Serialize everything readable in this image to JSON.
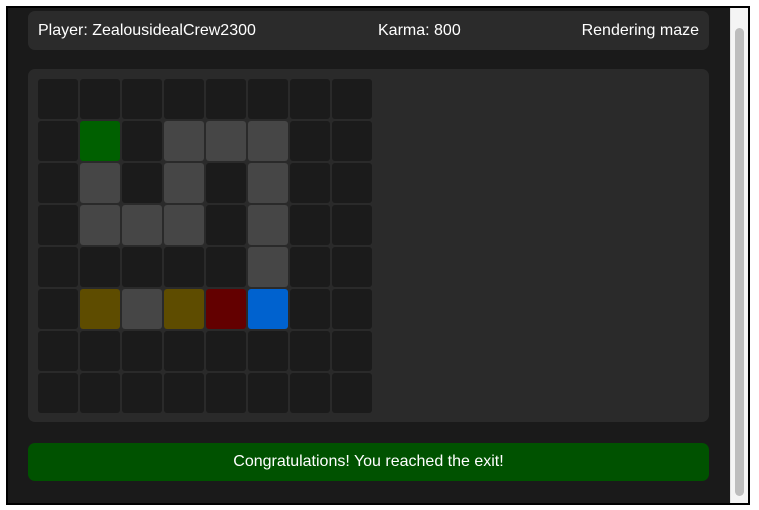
{
  "header": {
    "player": "Player: ZealousidealCrew2300",
    "karma": "Karma: 800",
    "status": "Rendering maze"
  },
  "maze": {
    "rows": 8,
    "cols": 8,
    "legend": {
      "W": "wall",
      "P": "path",
      "S": "start",
      "V": "visited",
      "X": "dead-end",
      "E": "exit"
    },
    "colors": {
      "W": "#1b1b1b",
      "P": "#464646",
      "S": "#006000",
      "V": "#5e4c00",
      "X": "#630000",
      "E": "#0062cf"
    },
    "grid": [
      "WWWWWWWW",
      "WSWPPPWW",
      "WPWPWPWW",
      "WPPPWPWW",
      "WWWWWPWW",
      "WVPVXEWW",
      "WWWWWWWW",
      "WWWWWWWW"
    ]
  },
  "message": "Congratulations! You reached the exit!"
}
